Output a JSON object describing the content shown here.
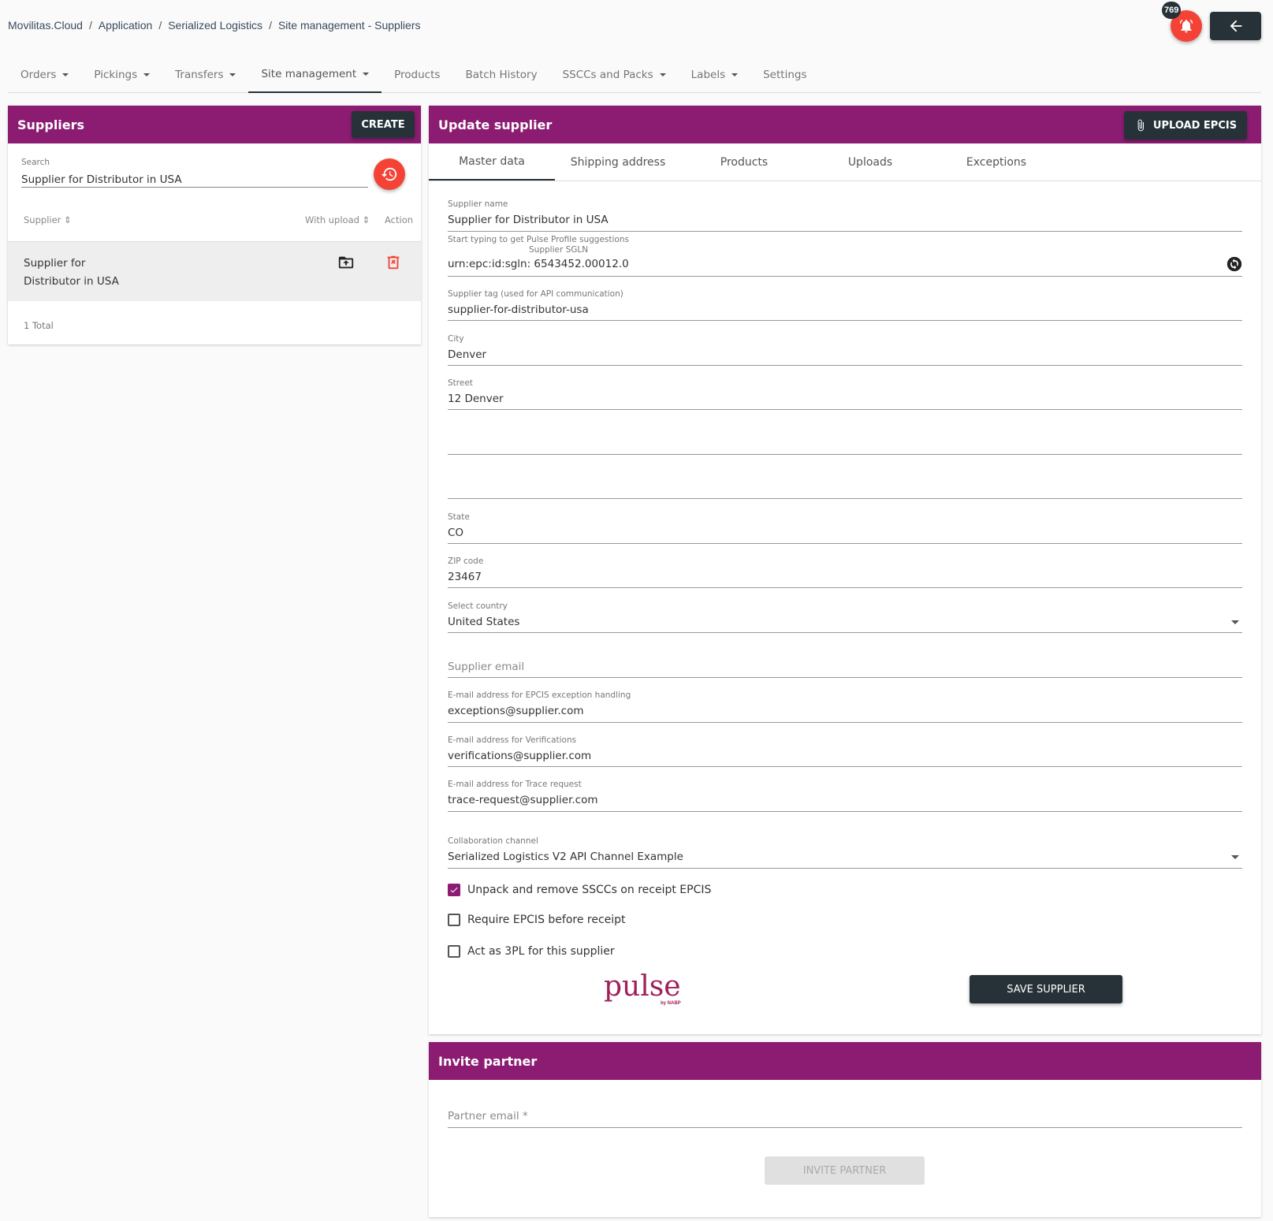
{
  "breadcrumb": [
    "Movilitas.Cloud",
    "Application",
    "Serialized Logistics",
    "Site management - Suppliers"
  ],
  "notifications": {
    "count": "769"
  },
  "nav": [
    {
      "label": "Orders",
      "dropdown": true
    },
    {
      "label": "Pickings",
      "dropdown": true
    },
    {
      "label": "Transfers",
      "dropdown": true
    },
    {
      "label": "Site management",
      "dropdown": true,
      "active": true
    },
    {
      "label": "Products",
      "dropdown": false
    },
    {
      "label": "Batch History",
      "dropdown": false
    },
    {
      "label": "SSCCs and Packs",
      "dropdown": true
    },
    {
      "label": "Labels",
      "dropdown": true
    },
    {
      "label": "Settings",
      "dropdown": false
    }
  ],
  "suppliers": {
    "title": "Suppliers",
    "create_label": "CREATE",
    "search_label": "Search",
    "search_value": "Supplier for Distributor in USA",
    "columns": [
      "Supplier",
      "With upload",
      "Action"
    ],
    "rows": [
      {
        "name_line1": "Supplier for",
        "name_line2": "Distributor in USA"
      }
    ],
    "total": "1 Total"
  },
  "update": {
    "title": "Update supplier",
    "upload_label": "UPLOAD EPCIS",
    "tabs": [
      "Master data",
      "Shipping address",
      "Products",
      "Uploads",
      "Exceptions"
    ],
    "supplier_name_label": "Supplier name",
    "supplier_name": "Supplier for Distributor in USA",
    "pulse_hint": "Start typing to get Pulse Profile suggestions",
    "sgln_label": "Supplier SGLN",
    "sgln": "urn:epc:id:sgln: 6543452.00012.0",
    "tag_label": "Supplier tag (used for API communication)",
    "tag": "supplier-for-distributor-usa",
    "city_label": "City",
    "city": "Denver",
    "street_label": "Street",
    "street": "12 Denver",
    "state_label": "State",
    "state": "CO",
    "zip_label": "ZIP code",
    "zip": "23467",
    "country_label": "Select country",
    "country": "United States",
    "email_placeholder": "Supplier email",
    "exc_label": "E-mail address for EPCIS exception handling",
    "exc": "exceptions@supplier.com",
    "ver_label": "E-mail address for Verifications",
    "ver": "verifications@supplier.com",
    "trace_label": "E-mail address for Trace request",
    "trace": "trace-request@supplier.com",
    "channel_label": "Collaboration channel",
    "channel": "Serialized Logistics V2 API Channel Example",
    "checkboxes": [
      {
        "label": "Unpack and remove SSCCs on receipt EPCIS",
        "checked": true
      },
      {
        "label": "Require EPCIS before receipt",
        "checked": false
      },
      {
        "label": "Act as 3PL for this supplier",
        "checked": false
      }
    ],
    "logo_text": "pulse",
    "logo_sub": "by NABP",
    "save_label": "SAVE SUPPLIER"
  },
  "invite": {
    "title": "Invite partner",
    "email_placeholder": "Partner email *",
    "button_label": "INVITE PARTNER"
  },
  "colors": {
    "header": "#8b1c72",
    "dark": "#263238",
    "accent": "#f44336"
  }
}
